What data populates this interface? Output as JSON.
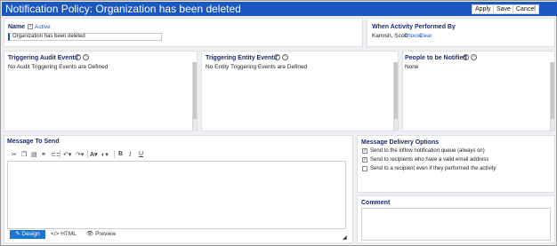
{
  "window": {
    "title": "Notification Policy: Organization has been deleted"
  },
  "toolbar": {
    "apply": "Apply",
    "save": "Save",
    "cancel": "Cancel"
  },
  "name_section": {
    "label": "Name",
    "active_label": "Active",
    "value": "Organization has been deleted"
  },
  "activity": {
    "label": "When Activity Performed By",
    "person": "Kamish, Scott",
    "choose": "Choose",
    "clear": "Clear"
  },
  "audit_events": {
    "label": "Triggering Audit Events",
    "text": "No Audit Triggering Events are Defined"
  },
  "entity_events": {
    "label": "Triggering Entity Events",
    "text": "No Entity Triggering Events are Defined"
  },
  "notified": {
    "label": "People to be Notified",
    "text": "None"
  },
  "message": {
    "label": "Message To Send",
    "tools": [
      "✂",
      "⎘",
      "📋",
      "⌫",
      "🔗",
      "</>",
      "↶",
      "↷",
      "A",
      "◐",
      "B",
      "I",
      "U"
    ],
    "tabs": {
      "design": "Design",
      "html": "HTML",
      "preview": "Preview"
    }
  },
  "delivery": {
    "label": "Message Delivery Options",
    "options": [
      {
        "text": "Send to the inflow notification queue (always on)",
        "checked": true
      },
      {
        "text": "Send to recipients who have a valid email address",
        "checked": true
      },
      {
        "text": "Send to a recipient even if they performed the activity",
        "checked": false
      }
    ]
  },
  "comment": {
    "label": "Comment"
  }
}
